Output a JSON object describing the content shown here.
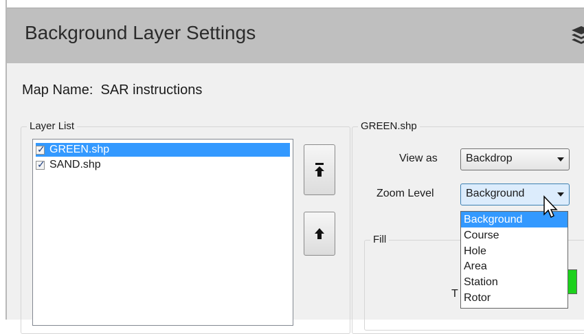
{
  "window": {
    "title": "Background Layer Settings"
  },
  "map_name": {
    "label": "Map Name:",
    "value": "SAR instructions"
  },
  "layer_list": {
    "group_label": "Layer List",
    "items": [
      {
        "label": "GREEN.shp",
        "checked": true,
        "selected": true
      },
      {
        "label": "SAND.shp",
        "checked": true,
        "selected": false
      }
    ]
  },
  "buttons": {
    "move_to_top": "move-to-top",
    "move_up": "move-up"
  },
  "layer_props": {
    "group_label": "GREEN.shp",
    "view_as_label": "View as",
    "view_as_value": "Backdrop",
    "zoom_level_label": "Zoom Level",
    "zoom_level_value": "Background",
    "zoom_options": [
      "Background",
      "Course",
      "Hole",
      "Area",
      "Station",
      "Rotor"
    ],
    "selected_option": "Background"
  },
  "fill": {
    "group_label": "Fill",
    "partial_label": "T",
    "swatch_color": "#1cd11c"
  },
  "colors": {
    "title_bar": "#bfbfbf",
    "selection": "#3399ff",
    "panel": "#f0f0f0"
  }
}
